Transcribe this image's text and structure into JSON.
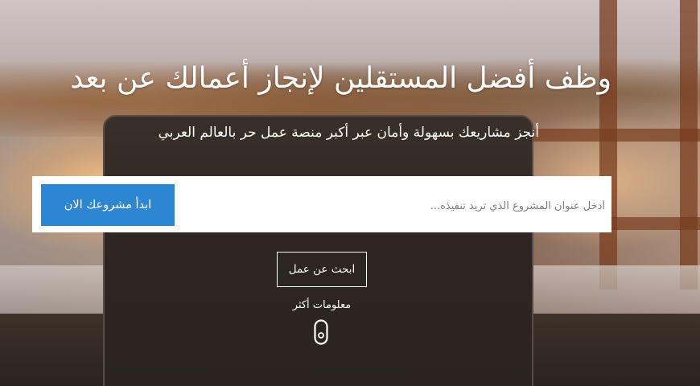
{
  "hero": {
    "headline": "وظف أفضل المستقلين لإنجاز أعمالك عن بعد",
    "subtitle": "أنجز مشاريعك بسهولة وأمان عبر أكبر منصة عمل حر بالعالم العربي"
  },
  "project_form": {
    "input_placeholder": "أدخل عنوان المشروع الذي تريد تنفيذه...",
    "input_value": "",
    "start_button_label": "ابدأ مشروعك الان"
  },
  "actions": {
    "find_work_label": "ابحث عن عمل",
    "more_info_label": "معلومات أكثر"
  },
  "icons": {
    "scroll": "mouse-scroll-icon"
  },
  "colors": {
    "primary_button": "#2c86d1",
    "text_on_hero": "#ffffff"
  }
}
